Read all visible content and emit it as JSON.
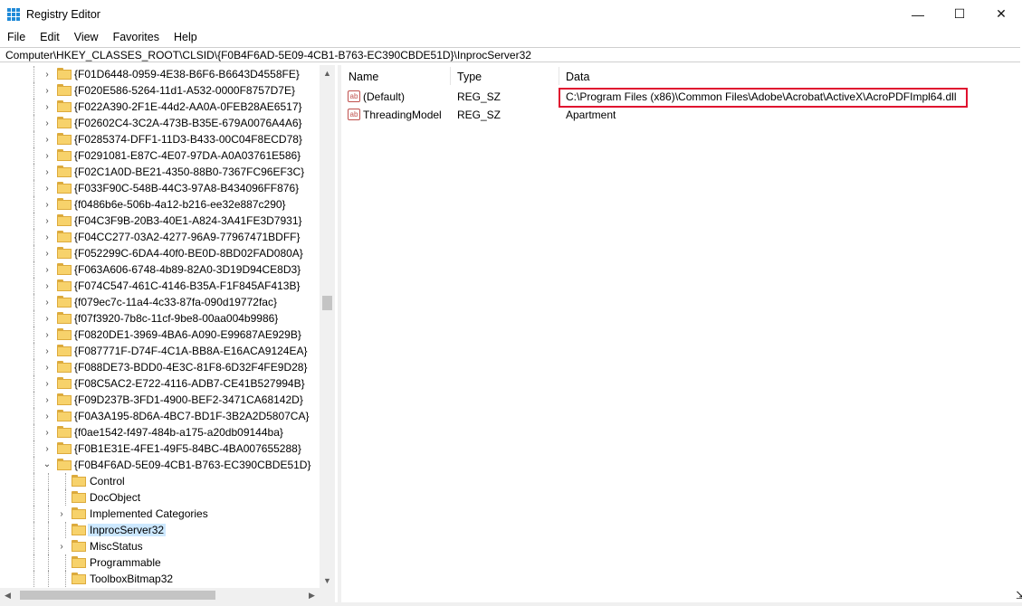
{
  "window": {
    "title": "Registry Editor"
  },
  "menu": [
    "File",
    "Edit",
    "View",
    "Favorites",
    "Help"
  ],
  "address": "Computer\\HKEY_CLASSES_ROOT\\CLSID\\{F0B4F6AD-5E09-4CB1-B763-EC390CBDE51D}\\InprocServer32",
  "tree": {
    "siblings": [
      "{F01D6448-0959-4E38-B6F6-B6643D4558FE}",
      "{F020E586-5264-11d1-A532-0000F8757D7E}",
      "{F022A390-2F1E-44d2-AA0A-0FEB28AE6517}",
      "{F02602C4-3C2A-473B-B35E-679A0076A4A6}",
      "{F0285374-DFF1-11D3-B433-00C04F8ECD78}",
      "{F0291081-E87C-4E07-97DA-A0A03761E586}",
      "{F02C1A0D-BE21-4350-88B0-7367FC96EF3C}",
      "{F033F90C-548B-44C3-97A8-B434096FF876}",
      "{f0486b6e-506b-4a12-b216-ee32e887c290}",
      "{F04C3F9B-20B3-40E1-A824-3A41FE3D7931}",
      "{F04CC277-03A2-4277-96A9-77967471BDFF}",
      "{F052299C-6DA4-40f0-BE0D-8BD02FAD080A}",
      "{F063A606-6748-4b89-82A0-3D19D94CE8D3}",
      "{F074C547-461C-4146-B35A-F1F845AF413B}",
      "{f079ec7c-11a4-4c33-87fa-090d19772fac}",
      "{f07f3920-7b8c-11cf-9be8-00aa004b9986}",
      "{F0820DE1-3969-4BA6-A090-E99687AE929B}",
      "{F087771F-D74F-4C1A-BB8A-E16ACA9124EA}",
      "{F088DE73-BDD0-4E3C-81F8-6D32F4FE9D28}",
      "{F08C5AC2-E722-4116-ADB7-CE41B527994B}",
      "{F09D237B-3FD1-4900-BEF2-3471CA68142D}",
      "{F0A3A195-8D6A-4BC7-BD1F-3B2A2D5807CA}",
      "{f0ae1542-f497-484b-a175-a20db09144ba}",
      "{F0B1E31E-4FE1-49F5-84BC-4BA007655288}"
    ],
    "expanded": "{F0B4F6AD-5E09-4CB1-B763-EC390CBDE51D}",
    "children": [
      {
        "label": "Control",
        "expandable": false
      },
      {
        "label": "DocObject",
        "expandable": false
      },
      {
        "label": "Implemented Categories",
        "expandable": true
      },
      {
        "label": "InprocServer32",
        "expandable": false,
        "selected": true
      },
      {
        "label": "MiscStatus",
        "expandable": true
      },
      {
        "label": "Programmable",
        "expandable": false
      },
      {
        "label": "ToolboxBitmap32",
        "expandable": false
      }
    ]
  },
  "list": {
    "columns": [
      "Name",
      "Type",
      "Data"
    ],
    "rows": [
      {
        "name": "(Default)",
        "type": "REG_SZ",
        "data": "C:\\Program Files (x86)\\Common Files\\Adobe\\Acrobat\\ActiveX\\AcroPDFImpl64.dll"
      },
      {
        "name": "ThreadingModel",
        "type": "REG_SZ",
        "data": "Apartment"
      }
    ]
  },
  "icons": {
    "value": "string-value-icon",
    "folder": "folder-icon"
  },
  "colors": {
    "accent": "#1f8ad8",
    "highlight": "#e0112f",
    "selection": "#cce8ff"
  }
}
